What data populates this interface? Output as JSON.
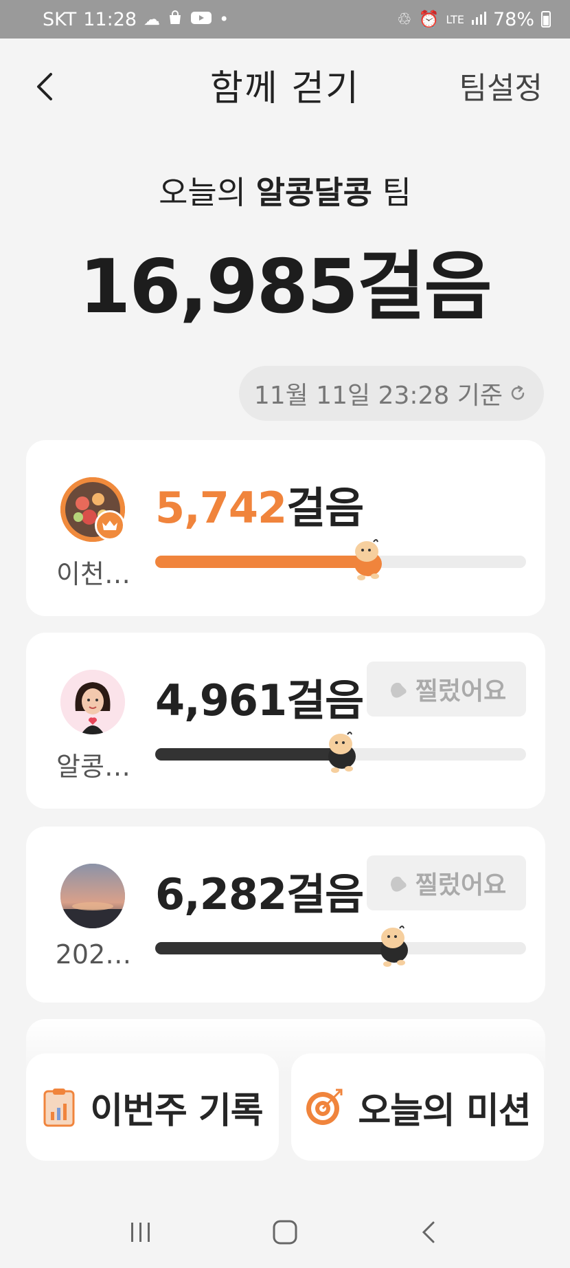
{
  "status_bar": {
    "carrier": "SKT",
    "time": "11:28",
    "network": "LTE",
    "battery": "78%"
  },
  "header": {
    "title": "함께 걷기",
    "settings_label": "팀설정"
  },
  "team": {
    "prefix": "오늘의 ",
    "name": "알콩달콩",
    "suffix": " 팀",
    "total_steps": "16,985걸음"
  },
  "timestamp": "11월 11일 23:28 기준",
  "members": [
    {
      "name": "이천…",
      "steps": "5,742",
      "unit": "걸음",
      "progress": 0.57,
      "is_leader": true,
      "poke_label": ""
    },
    {
      "name": "알콩…",
      "steps": "4,961",
      "unit": "걸음",
      "progress": 0.5,
      "is_leader": false,
      "poke_label": "찔렀어요"
    },
    {
      "name": "202…",
      "steps": "6,282",
      "unit": "걸음",
      "progress": 0.64,
      "is_leader": false,
      "poke_label": "찔렀어요"
    }
  ],
  "actions": {
    "weekly_record": "이번주 기록",
    "today_mission": "오늘의 미션"
  },
  "colors": {
    "accent": "#f0843c",
    "dark_bar": "#333333",
    "track": "#ececec"
  }
}
